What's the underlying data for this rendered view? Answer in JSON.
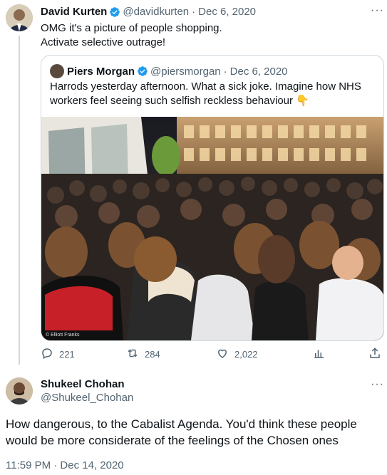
{
  "tweet": {
    "author_name": "David Kurten",
    "handle": "@davidkurten",
    "separator": "·",
    "date": "Dec 6, 2020",
    "text_line1": "OMG it's a picture of people shopping.",
    "text_line2": "Activate selective outrage!",
    "more_label": "···",
    "quote": {
      "author_name": "Piers Morgan",
      "handle": "@piersmorgan",
      "separator": "·",
      "date": "Dec 6, 2020",
      "text": "Harrods yesterday afternoon. What a sick joke. Imagine how NHS workers feel seeing such selfish reckless behaviour 👇",
      "photo_credit": "© Elliott Franks"
    },
    "actions": {
      "replies": "221",
      "retweets": "284",
      "likes": "2,022"
    }
  },
  "reply": {
    "author_name": "Shukeel Chohan",
    "handle": "@Shukeel_Chohan",
    "more_label": "···",
    "text": "How dangerous, to the Cabalist Agenda. You'd think these people would be more considerate of the feelings of the Chosen ones",
    "timestamp": "11:59 PM · Dec 14, 2020"
  },
  "colors": {
    "verified_blue": "#1d9bf0",
    "muted": "#536471",
    "border": "#cfd9de"
  }
}
